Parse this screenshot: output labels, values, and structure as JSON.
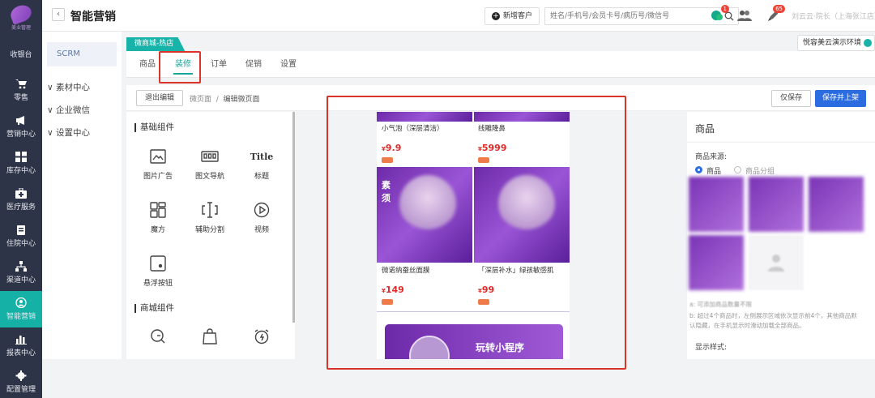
{
  "sidebar": {
    "brand": "美业管理",
    "items": [
      {
        "label": "收银台",
        "icon": "cashier-icon"
      },
      {
        "label": "零售",
        "icon": "cart-icon"
      },
      {
        "label": "营销中心",
        "icon": "megaphone-icon"
      },
      {
        "label": "库存中心",
        "icon": "grid-icon"
      },
      {
        "label": "医疗服务",
        "icon": "medical-kit-icon"
      },
      {
        "label": "住院中心",
        "icon": "clipboard-icon"
      },
      {
        "label": "渠道中心",
        "icon": "hierarchy-icon"
      },
      {
        "label": "智能营销",
        "icon": "smart-marketing-icon",
        "active": true
      },
      {
        "label": "报表中心",
        "icon": "bar-chart-icon"
      },
      {
        "label": "配置管理",
        "icon": "gear-icon"
      }
    ]
  },
  "header": {
    "back": "‹",
    "title": "智能营销",
    "new_customer": "新增客户",
    "search_placeholder": "姓名/手机号/会员卡号/病历号/微信号",
    "badge_chat": "1",
    "badge_rocket": "65",
    "user": "刘云云·院长（上海张江店）"
  },
  "subnav": {
    "active": "SCRM",
    "groups": [
      "素材中心",
      "企业微信",
      "设置中心"
    ]
  },
  "main": {
    "store_tag": "微商城-热店",
    "env_button": "悦容美云演示环境",
    "tabs": [
      "商品",
      "装修",
      "订单",
      "促销",
      "设置"
    ],
    "active_tab": "装修",
    "exit_edit": "退出编辑",
    "breadcrumb": [
      "微页面",
      "编辑微页面"
    ],
    "save_only": "仅保存",
    "save_publish": "保存并上架"
  },
  "components": {
    "basic_title": "基础组件",
    "basic": [
      {
        "label": "图片广告",
        "icon": "image-ad-icon"
      },
      {
        "label": "图文导航",
        "icon": "image-text-nav-icon"
      },
      {
        "label": "标题",
        "icon": "title-icon",
        "glyph": "Title"
      },
      {
        "label": "魔方",
        "icon": "magic-cube-icon"
      },
      {
        "label": "辅助分割",
        "icon": "divider-icon"
      },
      {
        "label": "视频",
        "icon": "video-icon"
      },
      {
        "label": "悬浮按钮",
        "icon": "float-button-icon"
      }
    ],
    "mall_title": "商城组件",
    "mall": [
      {
        "icon": "search-icon"
      },
      {
        "icon": "shopping-bag-icon"
      },
      {
        "icon": "alarm-clock-icon"
      }
    ]
  },
  "preview": {
    "products": [
      {
        "name": "小气泡（深层清洁）",
        "yen": "¥",
        "price": "9.9"
      },
      {
        "name": "线雕隆鼻",
        "yen": "¥",
        "price": "5999"
      },
      {
        "name": "微诺纳蚕丝面膜",
        "yen": "¥",
        "price": "149"
      },
      {
        "name": "「深层补水」绿孩敏感肌",
        "yen": "¥",
        "price": "99"
      }
    ],
    "overlay_text": "素须",
    "banner_text": "玩转小程序"
  },
  "right_panel": {
    "title": "商品",
    "source_label": "商品来源:",
    "source_options": [
      "商品",
      "商品分组"
    ],
    "note_a": "a: 可添加商品数量不限",
    "note_b": "b: 超过4个商品时，左侧展示区域依次显示前4个，其他商品默",
    "note_c": "认隐藏，在手机显示时滑动加载全部商品。",
    "display_label": "显示样式:"
  }
}
